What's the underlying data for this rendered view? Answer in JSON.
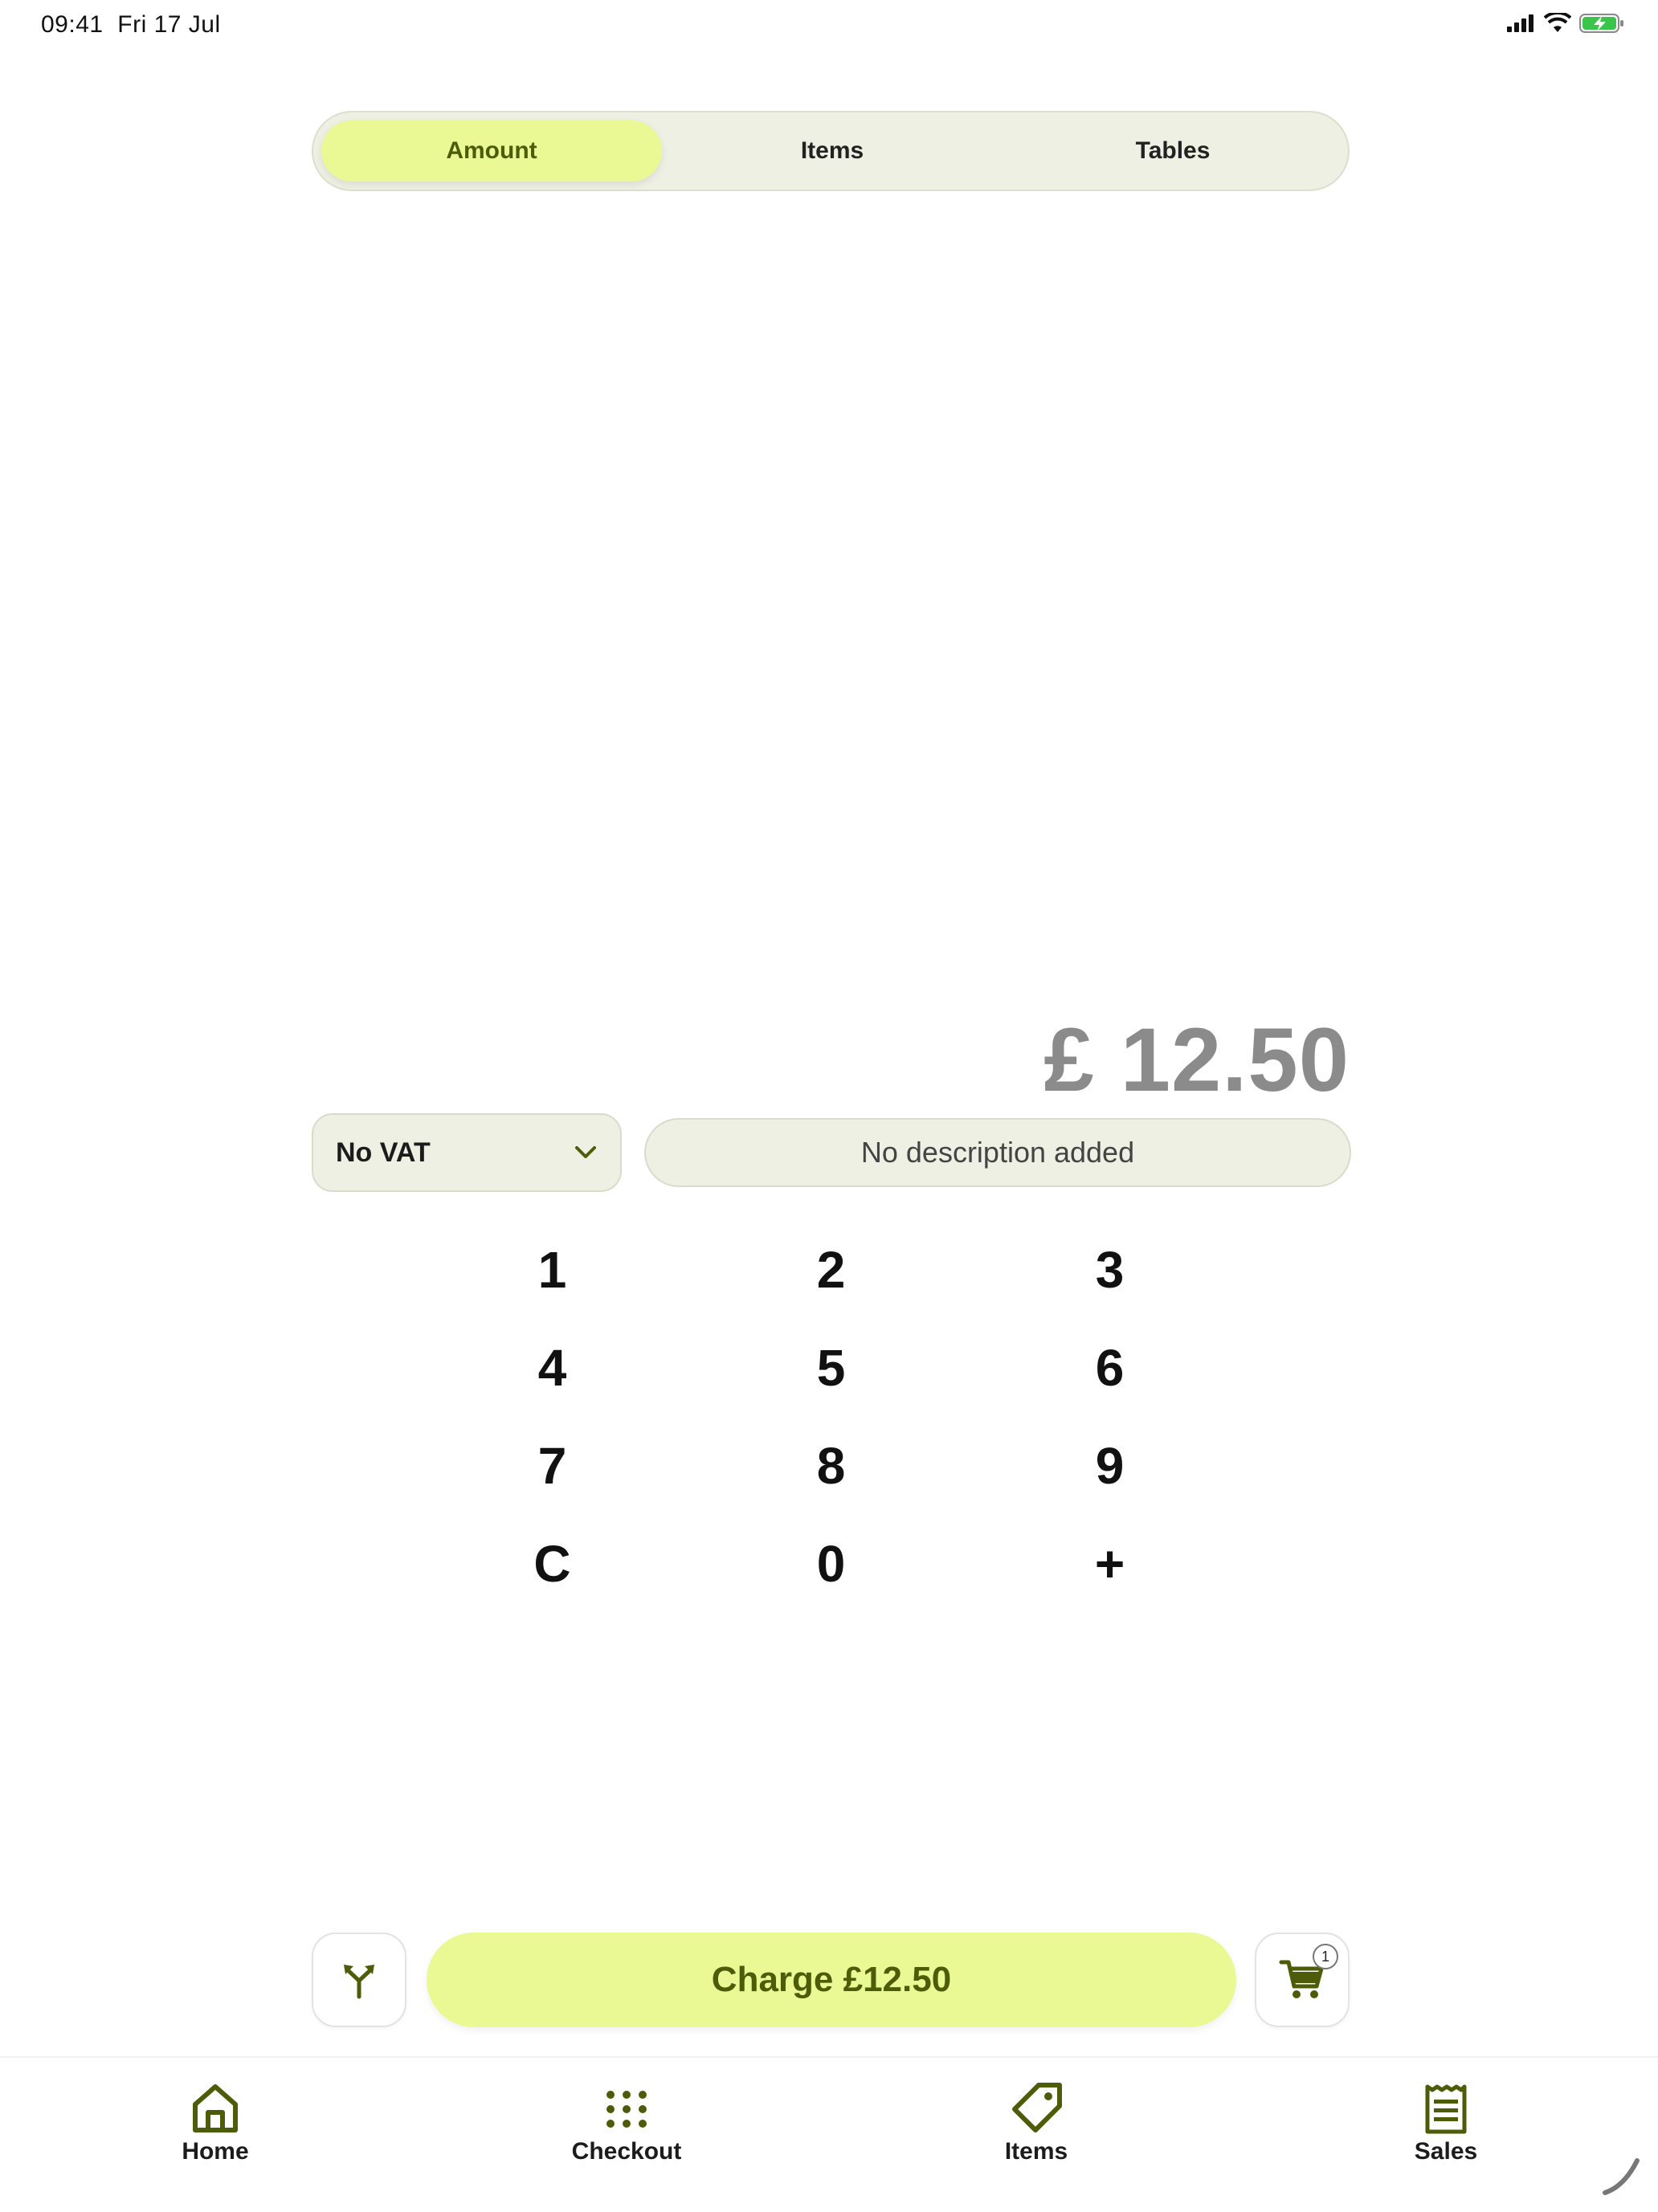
{
  "status_bar": {
    "time": "09:41",
    "date": "Fri 17 Jul"
  },
  "segments": [
    {
      "label": "Amount",
      "active": true
    },
    {
      "label": "Items",
      "active": false
    },
    {
      "label": "Tables",
      "active": false
    }
  ],
  "amount": {
    "display": "£ 12.50"
  },
  "vat": {
    "selected": "No VAT"
  },
  "description": {
    "placeholder": "No description added"
  },
  "keypad": {
    "keys": [
      "1",
      "2",
      "3",
      "4",
      "5",
      "6",
      "7",
      "8",
      "9",
      "C",
      "0",
      "+"
    ]
  },
  "actions": {
    "charge_label": "Charge £12.50",
    "cart_count": "1"
  },
  "tabbar": {
    "items": [
      {
        "label": "Home",
        "icon": "home-icon"
      },
      {
        "label": "Checkout",
        "icon": "grid-dots-icon"
      },
      {
        "label": "Items",
        "icon": "tag-icon"
      },
      {
        "label": "Sales",
        "icon": "receipt-icon"
      }
    ]
  },
  "colors": {
    "accent": "#ebf995",
    "accent_text": "#4c5c08",
    "field_bg": "#eef0e3",
    "amount_text": "#8b8b8b"
  }
}
